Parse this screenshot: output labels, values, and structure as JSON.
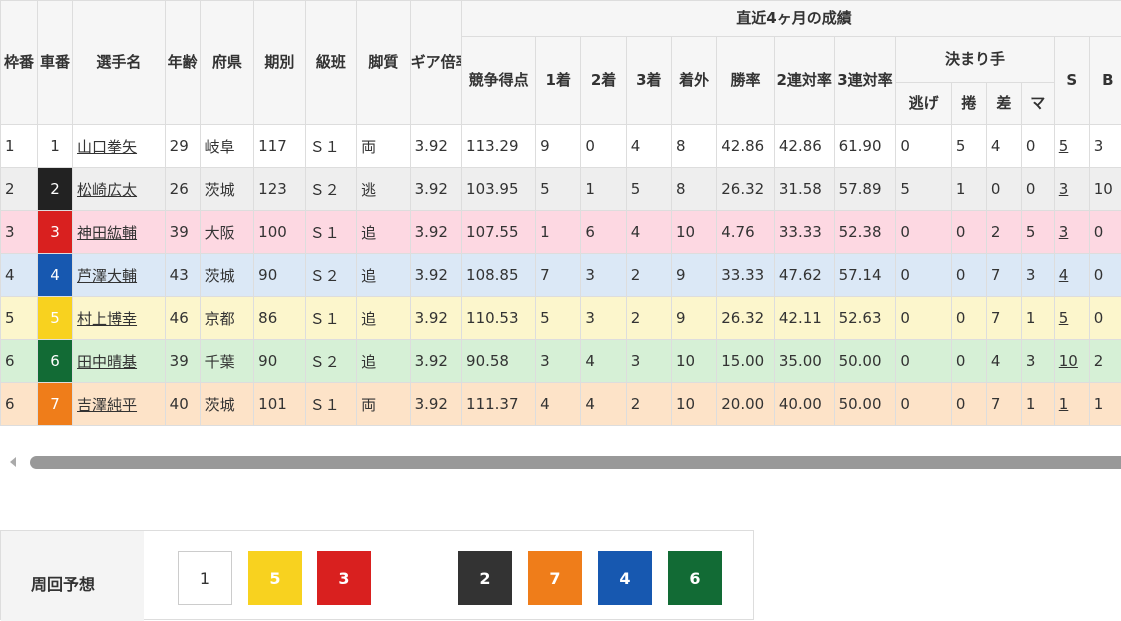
{
  "headers": {
    "waku": "枠番",
    "sha": "車番",
    "name": "選手名",
    "age": "年齢",
    "pref": "府県",
    "term": "期別",
    "class": "級班",
    "style": "脚質",
    "gear": "ギア倍率",
    "recent": "直近4ヶ月の成績",
    "score": "競争得点",
    "first": "1着",
    "second": "2着",
    "third": "3着",
    "out": "着外",
    "win_rate": "勝率",
    "quinella_rate": "2連対率",
    "trio_rate": "3連対率",
    "kimarite": "決まり手",
    "nige": "逃げ",
    "makuri": "捲",
    "sashi": "差",
    "ma": "マ",
    "s": "S",
    "b": "B"
  },
  "rows": [
    {
      "waku": "1",
      "sha": "1",
      "name": "山口拳矢",
      "age": "29",
      "pref": "岐阜",
      "term": "117",
      "class": "Ｓ１",
      "style": "両",
      "gear": "3.92",
      "score": "113.29",
      "first": "9",
      "second": "0",
      "third": "4",
      "out": "8",
      "win_rate": "42.86",
      "quinella_rate": "42.86",
      "trio_rate": "61.90",
      "nige": "0",
      "makuri": "5",
      "sashi": "4",
      "ma": "0",
      "s": "5",
      "b": "3"
    },
    {
      "waku": "2",
      "sha": "2",
      "name": "松崎広太",
      "age": "26",
      "pref": "茨城",
      "term": "123",
      "class": "Ｓ２",
      "style": "逃",
      "gear": "3.92",
      "score": "103.95",
      "first": "5",
      "second": "1",
      "third": "5",
      "out": "8",
      "win_rate": "26.32",
      "quinella_rate": "31.58",
      "trio_rate": "57.89",
      "nige": "5",
      "makuri": "1",
      "sashi": "0",
      "ma": "0",
      "s": "3",
      "b": "10"
    },
    {
      "waku": "3",
      "sha": "3",
      "name": "神田紘輔",
      "age": "39",
      "pref": "大阪",
      "term": "100",
      "class": "Ｓ１",
      "style": "追",
      "gear": "3.92",
      "score": "107.55",
      "first": "1",
      "second": "6",
      "third": "4",
      "out": "10",
      "win_rate": "4.76",
      "quinella_rate": "33.33",
      "trio_rate": "52.38",
      "nige": "0",
      "makuri": "0",
      "sashi": "2",
      "ma": "5",
      "s": "3",
      "b": "0"
    },
    {
      "waku": "4",
      "sha": "4",
      "name": "芦澤大輔",
      "age": "43",
      "pref": "茨城",
      "term": "90",
      "class": "Ｓ２",
      "style": "追",
      "gear": "3.92",
      "score": "108.85",
      "first": "7",
      "second": "3",
      "third": "2",
      "out": "9",
      "win_rate": "33.33",
      "quinella_rate": "47.62",
      "trio_rate": "57.14",
      "nige": "0",
      "makuri": "0",
      "sashi": "7",
      "ma": "3",
      "s": "4",
      "b": "0"
    },
    {
      "waku": "5",
      "sha": "5",
      "name": "村上博幸",
      "age": "46",
      "pref": "京都",
      "term": "86",
      "class": "Ｓ１",
      "style": "追",
      "gear": "3.92",
      "score": "110.53",
      "first": "5",
      "second": "3",
      "third": "2",
      "out": "9",
      "win_rate": "26.32",
      "quinella_rate": "42.11",
      "trio_rate": "52.63",
      "nige": "0",
      "makuri": "0",
      "sashi": "7",
      "ma": "1",
      "s": "5",
      "b": "0"
    },
    {
      "waku": "6",
      "sha": "6",
      "name": "田中晴基",
      "age": "39",
      "pref": "千葉",
      "term": "90",
      "class": "Ｓ２",
      "style": "追",
      "gear": "3.92",
      "score": "90.58",
      "first": "3",
      "second": "4",
      "third": "3",
      "out": "10",
      "win_rate": "15.00",
      "quinella_rate": "35.00",
      "trio_rate": "50.00",
      "nige": "0",
      "makuri": "0",
      "sashi": "4",
      "ma": "3",
      "s": "10",
      "b": "2"
    },
    {
      "waku": "6",
      "sha": "7",
      "name": "吉澤純平",
      "age": "40",
      "pref": "茨城",
      "term": "101",
      "class": "Ｓ１",
      "style": "両",
      "gear": "3.92",
      "score": "111.37",
      "first": "4",
      "second": "4",
      "third": "2",
      "out": "10",
      "win_rate": "20.00",
      "quinella_rate": "40.00",
      "trio_rate": "50.00",
      "nige": "0",
      "makuri": "0",
      "sashi": "7",
      "ma": "1",
      "s": "1",
      "b": "1"
    }
  ],
  "forecast": {
    "label": "周回予想",
    "items": [
      "1",
      "5",
      "3",
      "2",
      "7",
      "4",
      "6"
    ]
  },
  "colors": {
    "car1": "#ffffff",
    "car2": "#222222",
    "car3": "#d9201f",
    "car4": "#1758b0",
    "car5": "#f8d21f",
    "car6": "#126b35",
    "car7": "#ef7d1a"
  },
  "icons": {
    "scroll_left": "scroll-left-arrow-icon"
  }
}
